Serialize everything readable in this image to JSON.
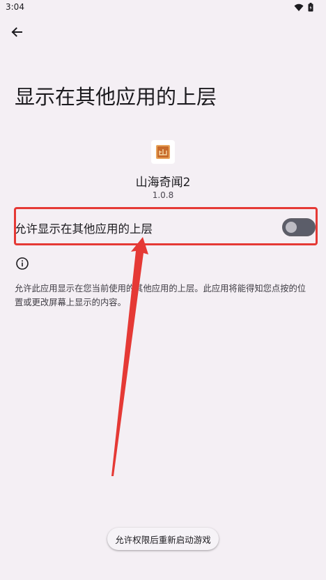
{
  "status_bar": {
    "time": "3:04",
    "icons": [
      "wifi-icon",
      "battery-icon"
    ]
  },
  "header": {
    "back_icon": "arrow-back-icon",
    "title": "显示在其他应用的上层"
  },
  "app": {
    "name": "山海奇闻2",
    "version": "1.0.8"
  },
  "permission": {
    "label": "允许显示在其他应用的上层",
    "enabled": false
  },
  "info": {
    "icon": "info-icon",
    "description": "允许此应用显示在您当前使用的其他应用的上层。此应用将能得知您点按的位置或更改屏幕上显示的内容。"
  },
  "restart_button": {
    "label": "允许权限后重新启动游戏"
  },
  "colors": {
    "background": "#f4eff4",
    "highlight": "#e53935",
    "switch_track": "#5b5d69",
    "switch_thumb": "#bdbcc4"
  }
}
